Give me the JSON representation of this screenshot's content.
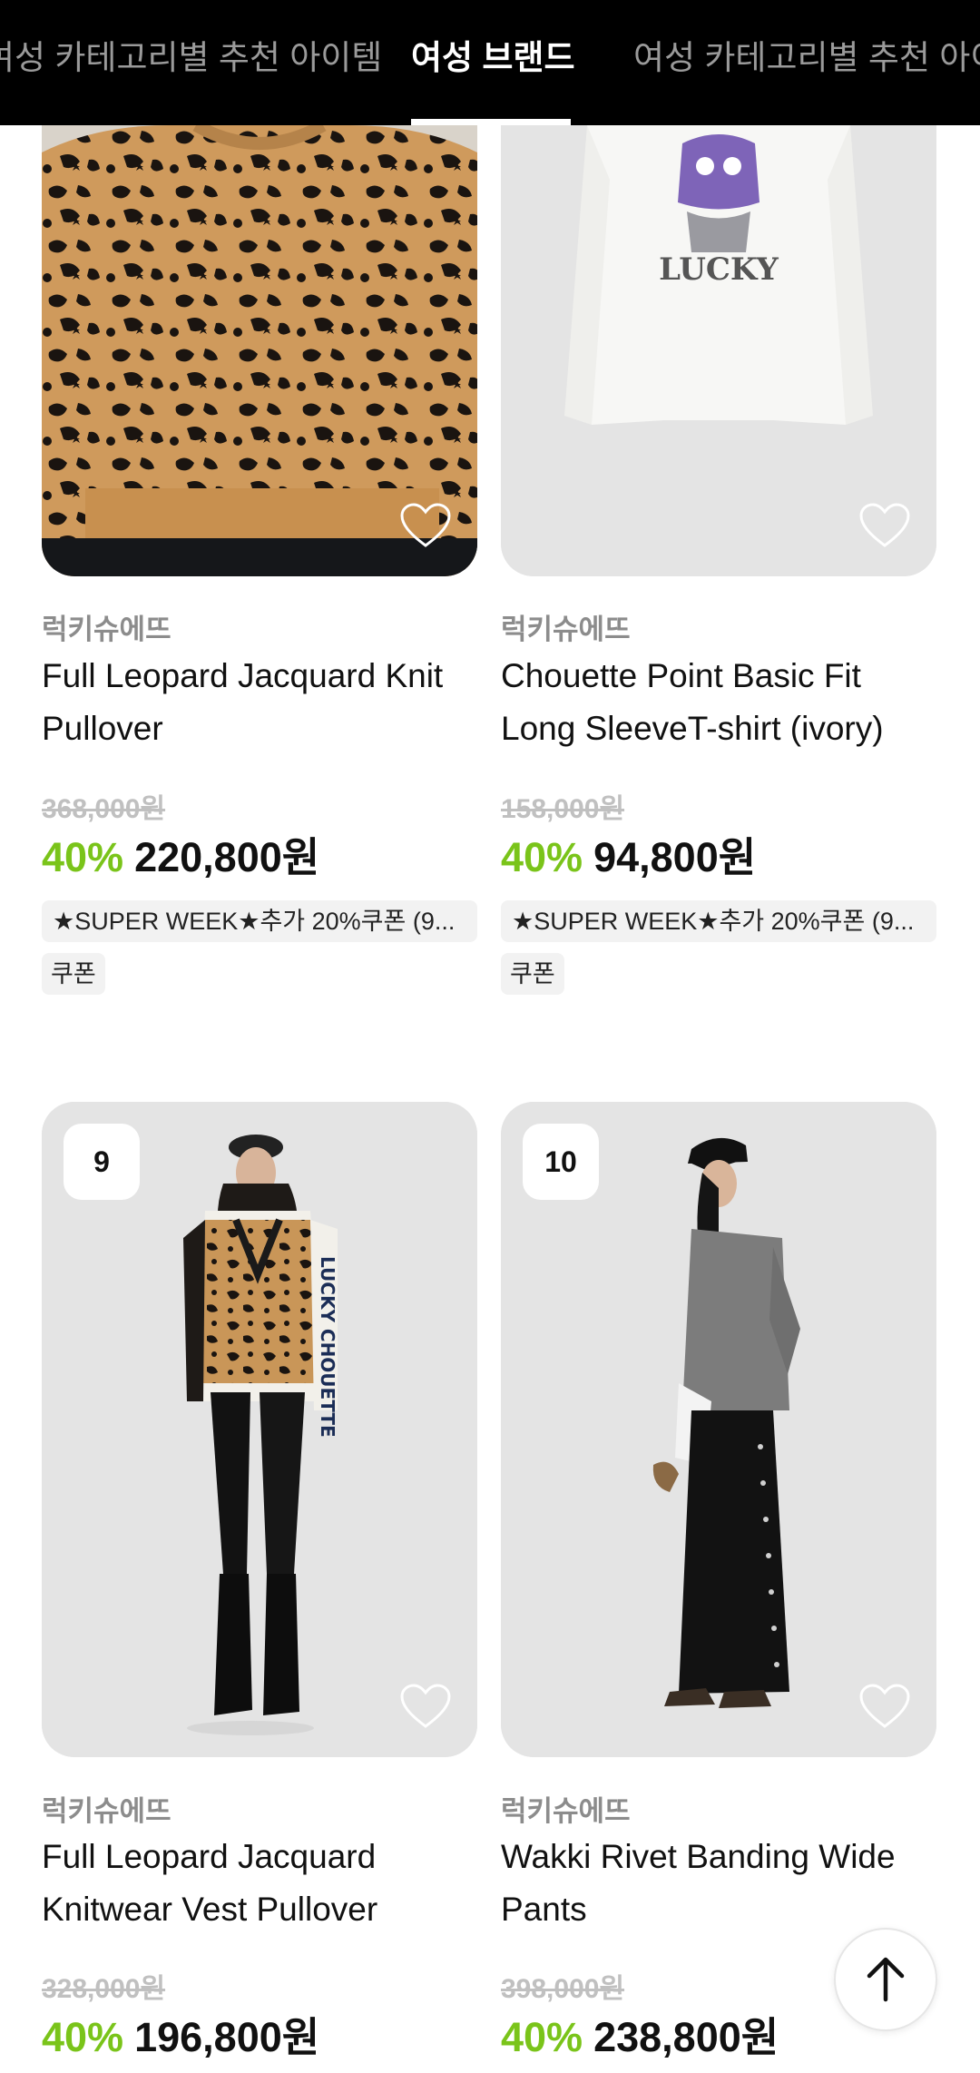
{
  "tabs": [
    {
      "label": "여성 카테고리별 추천 아이템",
      "active": false
    },
    {
      "label": "여성 브랜드",
      "active": true
    },
    {
      "label": "여성 카테고리별 추천 아이템",
      "active": false
    }
  ],
  "products": [
    {
      "brand": "럭키슈에뜨",
      "name": "Full Leopard Jacquard Knit Pullover",
      "original_price": "368,000원",
      "discount": "40%",
      "price": "220,800원",
      "coupon_text": "★SUPER WEEK★추가 20%쿠폰 (9...",
      "coupon_badge": "쿠폰",
      "heart_icon": "heart-outline-icon"
    },
    {
      "brand": "럭키슈에뜨",
      "name": "Chouette Point Basic Fit Long SleeveT-shirt (ivory)",
      "original_price": "158,000원",
      "discount": "40%",
      "price": "94,800원",
      "coupon_text": "★SUPER WEEK★추가 20%쿠폰 (9...",
      "coupon_badge": "쿠폰",
      "heart_icon": "heart-outline-icon"
    },
    {
      "rank": "9",
      "brand": "럭키슈에뜨",
      "name": "Full Leopard Jacquard Knitwear Vest Pullover",
      "original_price": "328,000원",
      "discount": "40%",
      "price": "196,800원",
      "heart_icon": "heart-outline-icon"
    },
    {
      "rank": "10",
      "brand": "럭키슈에뜨",
      "name": "Wakki Rivet Banding Wide Pants",
      "original_price": "398,000원",
      "discount": "40%",
      "price": "238,800원",
      "heart_icon": "heart-outline-icon"
    }
  ],
  "image_texts": {
    "tshirt_print": "LUCKY",
    "sleeve_print": "LUCKY CHOUETTE"
  },
  "colors": {
    "discount": "#7ac41a",
    "tabbar": "#000000",
    "image_bg": "#e4e4e4"
  },
  "scroll_top_icon": "arrow-up-icon"
}
